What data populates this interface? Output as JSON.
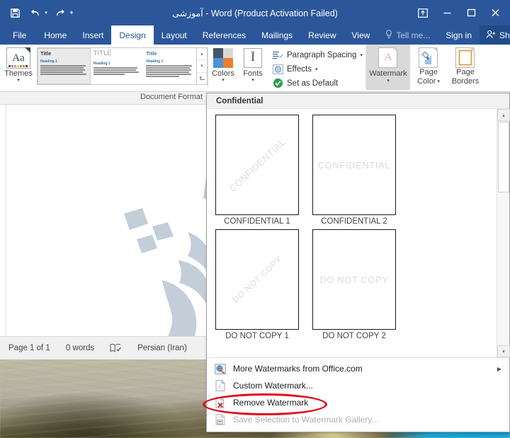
{
  "window": {
    "title": "آموزشی - Word (Product Activation Failed)",
    "quick_access": [
      {
        "name": "save-icon",
        "glyph": "save"
      },
      {
        "name": "undo-icon",
        "glyph": "undo"
      },
      {
        "name": "redo-icon",
        "glyph": "redo"
      },
      {
        "name": "customize-qat-icon",
        "glyph": "▾"
      }
    ],
    "controls": [
      {
        "name": "ribbon-display-options",
        "glyph": "⊼"
      },
      {
        "name": "minimize",
        "glyph": "—"
      },
      {
        "name": "maximize",
        "glyph": "▭"
      },
      {
        "name": "close",
        "glyph": "✕"
      }
    ],
    "titlebar_color": "#2b579a"
  },
  "tabs": [
    {
      "label": "File",
      "active": false
    },
    {
      "label": "Home",
      "active": false
    },
    {
      "label": "Insert",
      "active": false
    },
    {
      "label": "Design",
      "active": true
    },
    {
      "label": "Layout",
      "active": false
    },
    {
      "label": "References",
      "active": false
    },
    {
      "label": "Mailings",
      "active": false
    },
    {
      "label": "Review",
      "active": false
    },
    {
      "label": "View",
      "active": false
    }
  ],
  "tabs_right": {
    "tell_me": "Tell me...",
    "sign_in": "Sign in",
    "share": "Share"
  },
  "ribbon": {
    "themes": {
      "label": "Themes",
      "caret": "▾"
    },
    "gallery": [
      {
        "title": "Title",
        "heading": "Heading 1"
      },
      {
        "title": "TITLE",
        "heading": "Heading 1"
      },
      {
        "title": "Title",
        "heading": "Heading 1"
      }
    ],
    "gallery_scroll": {
      "up": "▴",
      "down": "▾",
      "more": "▾"
    },
    "colors": {
      "label": "Colors",
      "caret": "▾"
    },
    "fonts": {
      "label": "Fonts",
      "caret": "▾",
      "glyph": "Ĭ"
    },
    "small_commands": [
      {
        "label": "Paragraph Spacing",
        "caret": "▾",
        "icon": "paragraph-spacing-icon"
      },
      {
        "label": "Effects",
        "caret": "▾",
        "icon": "effects-icon"
      },
      {
        "label": "Set as Default",
        "caret": "",
        "icon": "set-as-default-icon"
      }
    ],
    "watermark": {
      "label": "Watermark",
      "caret": "▾"
    },
    "page_color": {
      "line1": "Page",
      "line2": "Color",
      "caret": "▾"
    },
    "page_borders": {
      "line1": "Page",
      "line2": "Borders"
    },
    "group_title": "Document Format"
  },
  "watermark_panel": {
    "category": "Confidential",
    "items": [
      {
        "label": "CONFIDENTIAL 1",
        "art_text": "CONFIDENTIAL",
        "orientation": "diagonal"
      },
      {
        "label": "CONFIDENTIAL 2",
        "art_text": "CONFIDENTIAL",
        "orientation": "horizontal"
      },
      {
        "label": "DO NOT COPY 1",
        "art_text": "DO NOT COPY",
        "orientation": "diagonal"
      },
      {
        "label": "DO NOT COPY 2",
        "art_text": "DO NOT COPY",
        "orientation": "horizontal"
      }
    ],
    "menu": [
      {
        "label": "More Watermarks from Office.com",
        "accel": "M",
        "disabled": false,
        "submenu": true,
        "icon": "office-online-icon"
      },
      {
        "label": "Custom Watermark...",
        "accel": "W",
        "disabled": false,
        "submenu": false,
        "icon": "custom-watermark-icon"
      },
      {
        "label": "Remove Watermark",
        "accel": "R",
        "disabled": false,
        "submenu": false,
        "icon": "remove-watermark-icon"
      },
      {
        "label": "Save Selection to Watermark Gallery...",
        "accel": "S",
        "disabled": true,
        "submenu": false,
        "icon": "save-selection-icon"
      }
    ],
    "scroll": {
      "up": "▴",
      "down": "▾"
    }
  },
  "status_bar": {
    "page": "Page 1 of 1",
    "words": "0 words",
    "proofing_icon": "proofing-errors-icon",
    "language": "Persian (Iran)"
  },
  "annotation": {
    "type": "ellipse",
    "color": "#e3051b",
    "targets": "Remove Watermark"
  }
}
